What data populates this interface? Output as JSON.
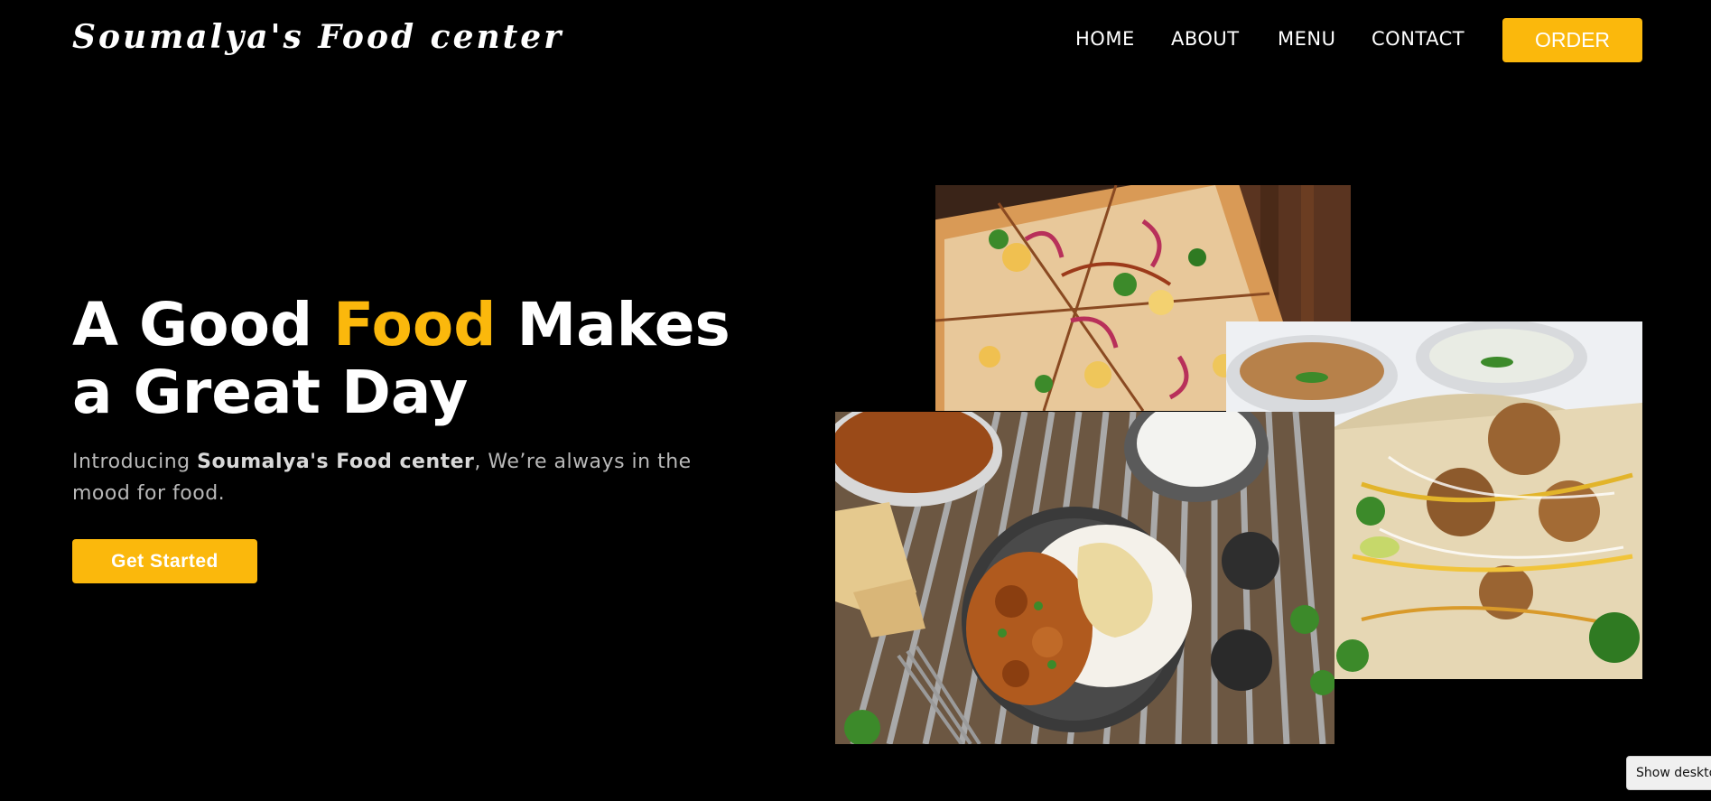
{
  "header": {
    "brand": "Soumalya's Food center",
    "nav": [
      "HOME",
      "ABOUT",
      "MENU",
      "CONTACT"
    ],
    "order_label": "ORDER"
  },
  "hero": {
    "headline_part1": "A Good ",
    "headline_accent": "Food",
    "headline_part2": " Makes",
    "headline_line2": "a Great Day",
    "intro_prefix": "Introducing ",
    "intro_brand": "Soumalya's Food center",
    "intro_suffix": ", We’re always in the mood for food.",
    "cta_label": "Get Started"
  },
  "tooltip": {
    "label": "Show desktop"
  },
  "colors": {
    "accent": "#fbb80c",
    "background": "#000000"
  }
}
